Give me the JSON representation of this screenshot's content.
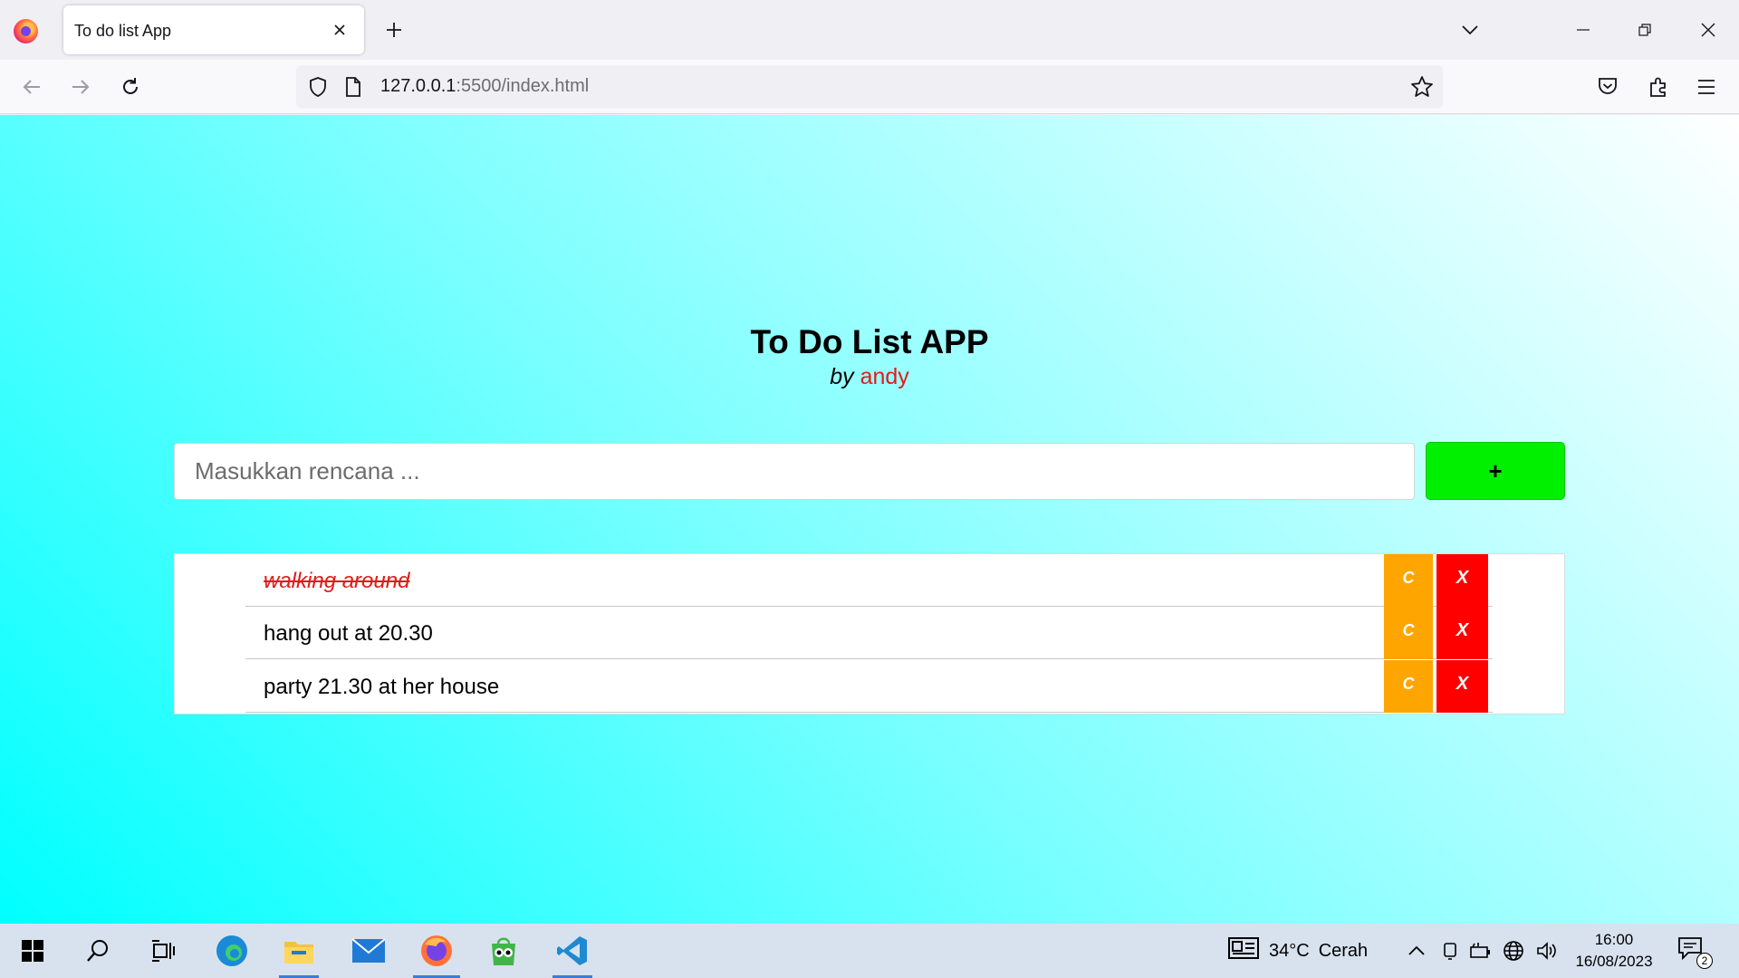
{
  "browser": {
    "tab_title": "To do list App",
    "url_host": "127.0.0.1",
    "url_path": ":5500/index.html"
  },
  "app": {
    "title": "To Do List APP",
    "by_label": "by",
    "author": "andy",
    "input_placeholder": "Masukkan rencana ...",
    "add_label": "+",
    "complete_label": "C",
    "delete_label": "X",
    "items": [
      {
        "text": "walking around",
        "completed": true
      },
      {
        "text": "hang out at 20.30",
        "completed": false
      },
      {
        "text": "party 21.30 at her house",
        "completed": false
      }
    ]
  },
  "taskbar": {
    "weather_temp": "34°C",
    "weather_desc": "Cerah",
    "time": "16:00",
    "date": "16/08/2023",
    "notification_count": "2"
  },
  "colors": {
    "accent_green": "#00f000",
    "complete_orange": "#ffa500",
    "delete_red": "#ff0000",
    "author_red": "#e21b1b",
    "background_cyan": "#00ffff"
  }
}
